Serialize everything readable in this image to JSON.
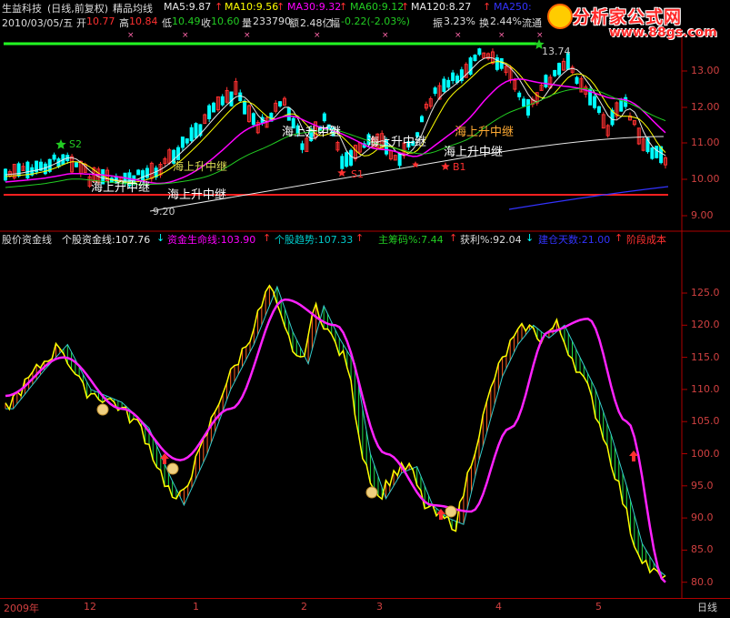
{
  "header": {
    "stock_name": "生益科技",
    "period": "(日线,前复权)",
    "indicator": "精品均线",
    "ma5": "MA5:9.87",
    "ma10": "MA10:9.56",
    "ma30": "MA30:9.32",
    "ma60": "MA60:9.12",
    "ma120": "MA120:8.27",
    "ma250": "MA250:",
    "date": "2010/03/05/五",
    "open_label": "开",
    "open": "10.77",
    "high_label": "高",
    "high": "10.84",
    "low_label": "低",
    "low": "10.49",
    "close_label": "收",
    "close": "10.60",
    "volume_label": "量",
    "volume": "233790",
    "amount_label": "额",
    "amount": "2.48亿",
    "change_label": "幅",
    "change": "-0.22(-2.03%)",
    "amplitude_label": "振",
    "amplitude": "3.23%",
    "turnover_label": "换",
    "turnover": "2.44%",
    "circulation_label": "流通"
  },
  "logo": {
    "title": "分析家公式网",
    "url": "www.88gs.com"
  },
  "price_chart": {
    "price_axis": [
      "13.00",
      "12.00",
      "11.00",
      "10.00",
      "9.00"
    ],
    "peak_label": "13.74",
    "low_label": "9.20",
    "signals": [
      {
        "text": "S2",
        "color": "#22cc22"
      },
      {
        "text": "S1",
        "color": "#ff3030"
      },
      {
        "text": "B1",
        "color": "#ff3030"
      }
    ],
    "annotations": [
      "海上升中继",
      "海上升中继",
      "海上升中继",
      "海上升中继",
      "海上升中继",
      "海上升中继",
      "海上升中继"
    ]
  },
  "indicator_header": {
    "name": "股价资金线",
    "l1": "个股资金线:107.76",
    "l2": "资金生命线:103.90",
    "l3": "个股趋势:107.33",
    "l4": "主筹码%:7.44",
    "l5": "获利%:92.04",
    "l6": "建仓天数:21.00",
    "l7": "阶段成本"
  },
  "indicator_chart": {
    "axis": [
      "125.0",
      "120.0",
      "115.0",
      "110.0",
      "105.0",
      "100.0",
      "95.0",
      "90.0",
      "85.0",
      "80.0"
    ]
  },
  "time_axis": {
    "labels": [
      "2009年",
      "12",
      "1",
      "2",
      "3",
      "4",
      "5"
    ],
    "period_button": "日线"
  },
  "colors": {
    "up": "#ff3030",
    "down": "#00ffff",
    "ma_white": "#e8e8e8",
    "ma_yellow": "#ffff00",
    "ma_magenta": "#ff00ff",
    "ma_green": "#22cc22",
    "ma_blue": "#3333ff",
    "grid_red": "#b00000"
  }
}
